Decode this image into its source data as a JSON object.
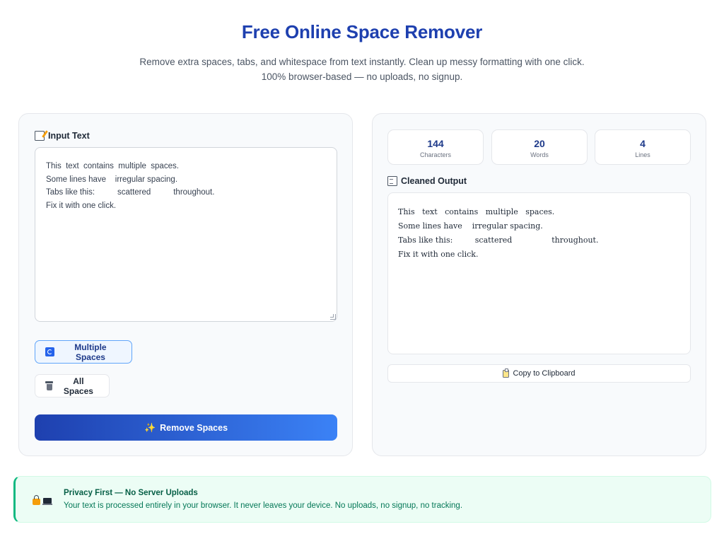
{
  "header": {
    "title": "Free Online Space Remover",
    "subtitle": "Remove extra spaces, tabs, and whitespace from text instantly. Clean up messy formatting with one click. 100% browser-based — no uploads, no signup."
  },
  "input_panel": {
    "label": "Input Text",
    "label_icon": "memo-icon",
    "text": "This  text  contains  multiple  spaces.\nSome lines have    irregular spacing.\nTabs like this:          scattered          throughout.\nFix it with one click.",
    "modes": [
      {
        "label": "Multiple Spaces",
        "icon": "refresh-icon",
        "active": true
      },
      {
        "label": "All Spaces",
        "icon": "trash-icon",
        "active": false
      }
    ],
    "remove_button": {
      "label": "Remove Spaces",
      "icon": "sparkle-icon"
    }
  },
  "output_panel": {
    "stats": [
      {
        "value": "144",
        "label": "Characters"
      },
      {
        "value": "20",
        "label": "Words"
      },
      {
        "value": "4",
        "label": "Lines"
      }
    ],
    "label": "Cleaned Output",
    "label_icon": "document-icon",
    "text": "This   text   contains   multiple   spaces.\nSome lines have    irregular spacing.\nTabs like this:         scattered                throughout.\nFix it with one click.",
    "copy_button": {
      "label": "Copy to Clipboard",
      "icon": "clipboard-icon"
    }
  },
  "privacy": {
    "title": "Privacy First — No Server Uploads",
    "text": "Your text is processed entirely in your browser. It never leaves your device. No uploads, no signup, no tracking.",
    "icons": [
      "lock-icon",
      "laptop-icon"
    ]
  },
  "colors": {
    "brand": "#1e40af",
    "accent": "#3b82f6",
    "privacy_accent": "#10b981"
  }
}
